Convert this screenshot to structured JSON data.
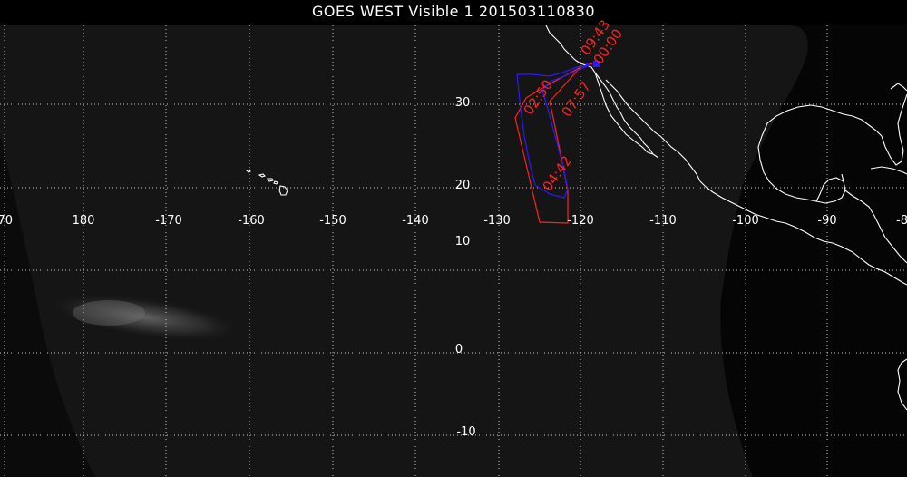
{
  "title": "GOES WEST Visible 1 201503110830",
  "colors": {
    "background": "#000000",
    "disk": "#151515",
    "grid": "#cccccc",
    "coast": "#ffffff",
    "track_red": "#ff2020",
    "track_blue": "#2a1aff"
  },
  "grid": {
    "lon_labels": [
      "70",
      "180",
      "-170",
      "-160",
      "-150",
      "-140",
      "-130",
      "-120",
      "-110",
      "-100",
      "-90",
      "-8"
    ],
    "lat_labels": [
      "30",
      "20",
      "10",
      "0",
      "-10"
    ]
  },
  "track": {
    "time_labels": [
      "09:43",
      "00:00",
      "02:50",
      "07:57",
      "04:42"
    ]
  }
}
